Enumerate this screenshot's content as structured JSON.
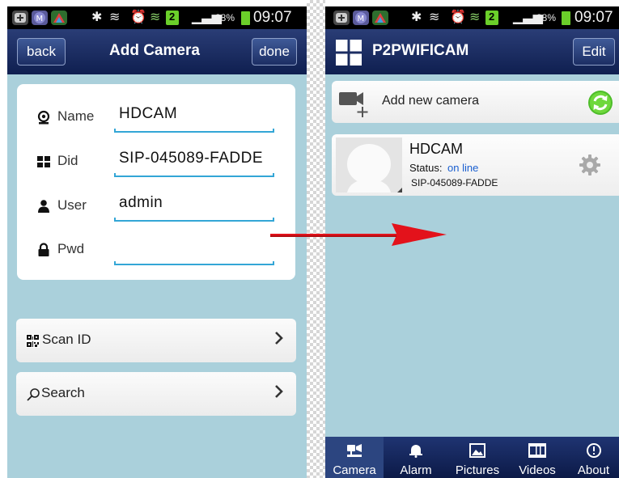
{
  "status_bar": {
    "battery_percent": "88%",
    "time": "09:07",
    "sim_badge": "2"
  },
  "left_screen": {
    "title": "Add Camera",
    "back_label": "back",
    "done_label": "done",
    "form": {
      "name": {
        "label": "Name",
        "value": "HDCAM"
      },
      "did": {
        "label": "Did",
        "value": "SIP-045089-FADDE"
      },
      "user": {
        "label": "User",
        "value": "admin"
      },
      "pwd": {
        "label": "Pwd",
        "value": ""
      }
    },
    "scan_id_label": "Scan ID",
    "search_label": "Search"
  },
  "right_screen": {
    "title": "P2PWIFICAM",
    "edit_label": "Edit",
    "add_camera_label": "Add new camera",
    "camera": {
      "name": "HDCAM",
      "status_label": "Status:",
      "status_value": "on line",
      "did": "SIP-045089-FADDE"
    },
    "tabs": [
      {
        "label": "Camera",
        "icon": "camera-icon",
        "active": true
      },
      {
        "label": "Alarm",
        "icon": "alarm-bell-icon",
        "active": false
      },
      {
        "label": "Pictures",
        "icon": "pictures-icon",
        "active": false
      },
      {
        "label": "Videos",
        "icon": "videos-icon",
        "active": false
      },
      {
        "label": "About",
        "icon": "about-icon",
        "active": false
      }
    ]
  },
  "colors": {
    "header_bg": "#1a2a5e",
    "content_bg": "#aad0db",
    "field_underline": "#33a6d6",
    "status_online": "#1a5fd0",
    "arrow_red": "#e3121b"
  }
}
